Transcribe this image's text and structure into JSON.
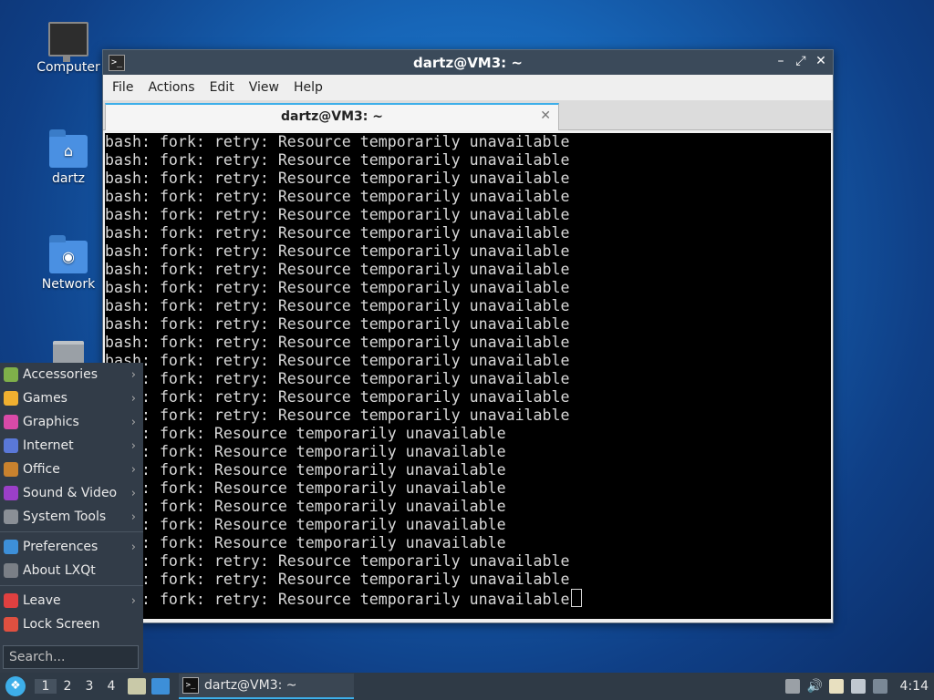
{
  "desktop": {
    "icons": [
      {
        "label": "Computer"
      },
      {
        "label": "dartz"
      },
      {
        "label": "Network"
      }
    ]
  },
  "window": {
    "title": "dartz@VM3: ~",
    "menus": [
      "File",
      "Actions",
      "Edit",
      "View",
      "Help"
    ],
    "tab_title": "dartz@VM3: ~",
    "terminal_lines": [
      "bash: fork: retry: Resource temporarily unavailable",
      "bash: fork: retry: Resource temporarily unavailable",
      "bash: fork: retry: Resource temporarily unavailable",
      "bash: fork: retry: Resource temporarily unavailable",
      "bash: fork: retry: Resource temporarily unavailable",
      "bash: fork: retry: Resource temporarily unavailable",
      "bash: fork: retry: Resource temporarily unavailable",
      "bash: fork: retry: Resource temporarily unavailable",
      "bash: fork: retry: Resource temporarily unavailable",
      "bash: fork: retry: Resource temporarily unavailable",
      "bash: fork: retry: Resource temporarily unavailable",
      "bash: fork: retry: Resource temporarily unavailable",
      "bash: fork: retry: Resource temporarily unavailable",
      "bash: fork: retry: Resource temporarily unavailable",
      "bash: fork: retry: Resource temporarily unavailable",
      "bash: fork: retry: Resource temporarily unavailable",
      "bash: fork: Resource temporarily unavailable",
      "bash: fork: Resource temporarily unavailable",
      "bash: fork: Resource temporarily unavailable",
      "bash: fork: Resource temporarily unavailable",
      "bash: fork: Resource temporarily unavailable",
      "bash: fork: Resource temporarily unavailable",
      "bash: fork: Resource temporarily unavailable",
      "bash: fork: retry: Resource temporarily unavailable",
      "bash: fork: retry: Resource temporarily unavailable",
      "bash: fork: retry: Resource temporarily unavailable"
    ]
  },
  "start_menu": {
    "items": [
      {
        "label": "Accessories",
        "icon": "accessories-icon",
        "color": "#7fb04a"
      },
      {
        "label": "Games",
        "icon": "games-icon",
        "color": "#f0b030"
      },
      {
        "label": "Graphics",
        "icon": "graphics-icon",
        "color": "#d94aa8"
      },
      {
        "label": "Internet",
        "icon": "internet-icon",
        "color": "#5a78d8"
      },
      {
        "label": "Office",
        "icon": "office-icon",
        "color": "#c9822e"
      },
      {
        "label": "Sound & Video",
        "icon": "sound-video-icon",
        "color": "#9b3fc8"
      },
      {
        "label": "System Tools",
        "icon": "system-tools-icon",
        "color": "#8a8f96"
      }
    ],
    "prefs": [
      {
        "label": "Preferences",
        "icon": "preferences-icon",
        "color": "#3d8fd8",
        "submenu": true
      },
      {
        "label": "About LXQt",
        "icon": "about-icon",
        "color": "#7a7f86",
        "submenu": false
      }
    ],
    "session": [
      {
        "label": "Leave",
        "icon": "leave-icon",
        "color": "#e04040",
        "submenu": true
      },
      {
        "label": "Lock Screen",
        "icon": "lock-icon",
        "color": "#e05040",
        "submenu": false
      }
    ],
    "search_placeholder": "Search..."
  },
  "taskbar": {
    "desktops": [
      "1",
      "2",
      "3",
      "4"
    ],
    "active_desktop": "1",
    "task_label": "dartz@VM3: ~",
    "clock": "4:14"
  },
  "colors": {
    "accent": "#3daee9",
    "panel": "#2f3a46",
    "titlebar": "#3b4a5a"
  }
}
